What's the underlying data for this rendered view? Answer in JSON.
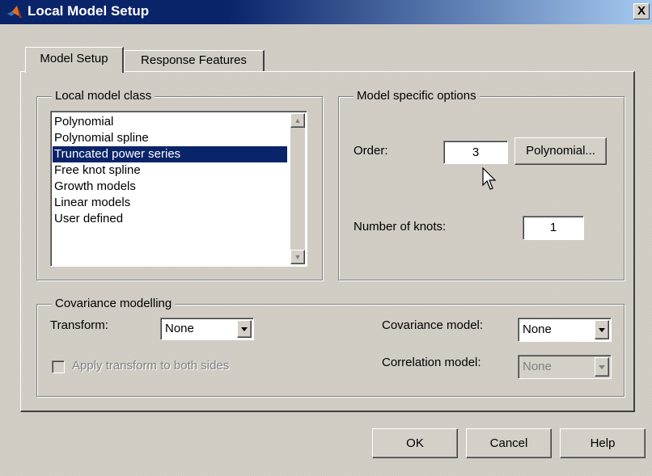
{
  "window": {
    "title": "Local Model Setup",
    "close_glyph": "X"
  },
  "tabs": [
    {
      "label": "Model Setup",
      "active": true
    },
    {
      "label": "Response Features",
      "active": false
    }
  ],
  "local_model_class": {
    "label": "Local model class",
    "items": [
      "Polynomial",
      "Polynomial spline",
      "Truncated power series",
      "Free knot spline",
      "Growth models",
      "Linear models",
      "User defined"
    ],
    "selected": "Truncated power series"
  },
  "model_options": {
    "label": "Model specific options",
    "order_label": "Order:",
    "order_value": "3",
    "polynomial_button": "Polynomial...",
    "knots_label": "Number of knots:",
    "knots_value": "1"
  },
  "covariance": {
    "label": "Covariance modelling",
    "transform_label": "Transform:",
    "transform_value": "None",
    "apply_transform_label": "Apply transform to both sides",
    "apply_transform_checked": false,
    "covariance_model_label": "Covariance model:",
    "covariance_model_value": "None",
    "correlation_model_label": "Correlation model:",
    "correlation_model_value": "None"
  },
  "buttons": {
    "ok": "OK",
    "cancel": "Cancel",
    "help": "Help"
  },
  "icons": {
    "title_icon": "matlab-logo-icon",
    "cursor": "mouse-pointer-icon"
  },
  "colors": {
    "titlebar": "#0a246a",
    "selection": "#0a246a",
    "face": "#d4d0c8"
  }
}
